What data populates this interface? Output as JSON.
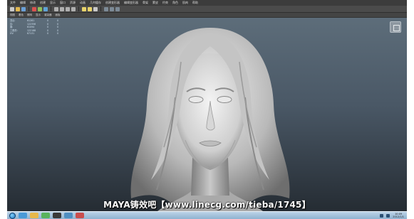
{
  "menubar": {
    "items": [
      "文件",
      "编辑",
      "修改",
      "创建",
      "显示",
      "窗口",
      "资源",
      "动画",
      "几何缓存",
      "创建变形器",
      "编辑变形器",
      "骨架",
      "蒙皮",
      "约束",
      "角色",
      "肌肉",
      "帮助"
    ]
  },
  "panelbar": {
    "items": [
      "视图",
      "着色",
      "照明",
      "显示",
      "渲染器",
      "面板"
    ]
  },
  "hud": {
    "rows": [
      {
        "label": "顶点:",
        "a": "61281",
        "b": "0",
        "c": "0"
      },
      {
        "label": "边:",
        "a": "122356",
        "b": "0",
        "c": "0"
      },
      {
        "label": "面:",
        "a": "61094",
        "b": "0",
        "c": "0"
      },
      {
        "label": "三角形:",
        "a": "122188",
        "b": "0",
        "c": "0"
      },
      {
        "label": "UV:",
        "a": "67131",
        "b": "0",
        "c": "0"
      }
    ]
  },
  "watermark": {
    "text": "MAYA铸效吧【www.linecg.com/tieba/1745】"
  },
  "taskbar": {
    "clock_time": "10:09",
    "clock_date": "2012/1/1"
  },
  "colors": {
    "viewport_top": "#5d6d7a",
    "viewport_bottom": "#252c33",
    "model": "#d3d3d3",
    "taskbar": "#a7c3dc"
  }
}
